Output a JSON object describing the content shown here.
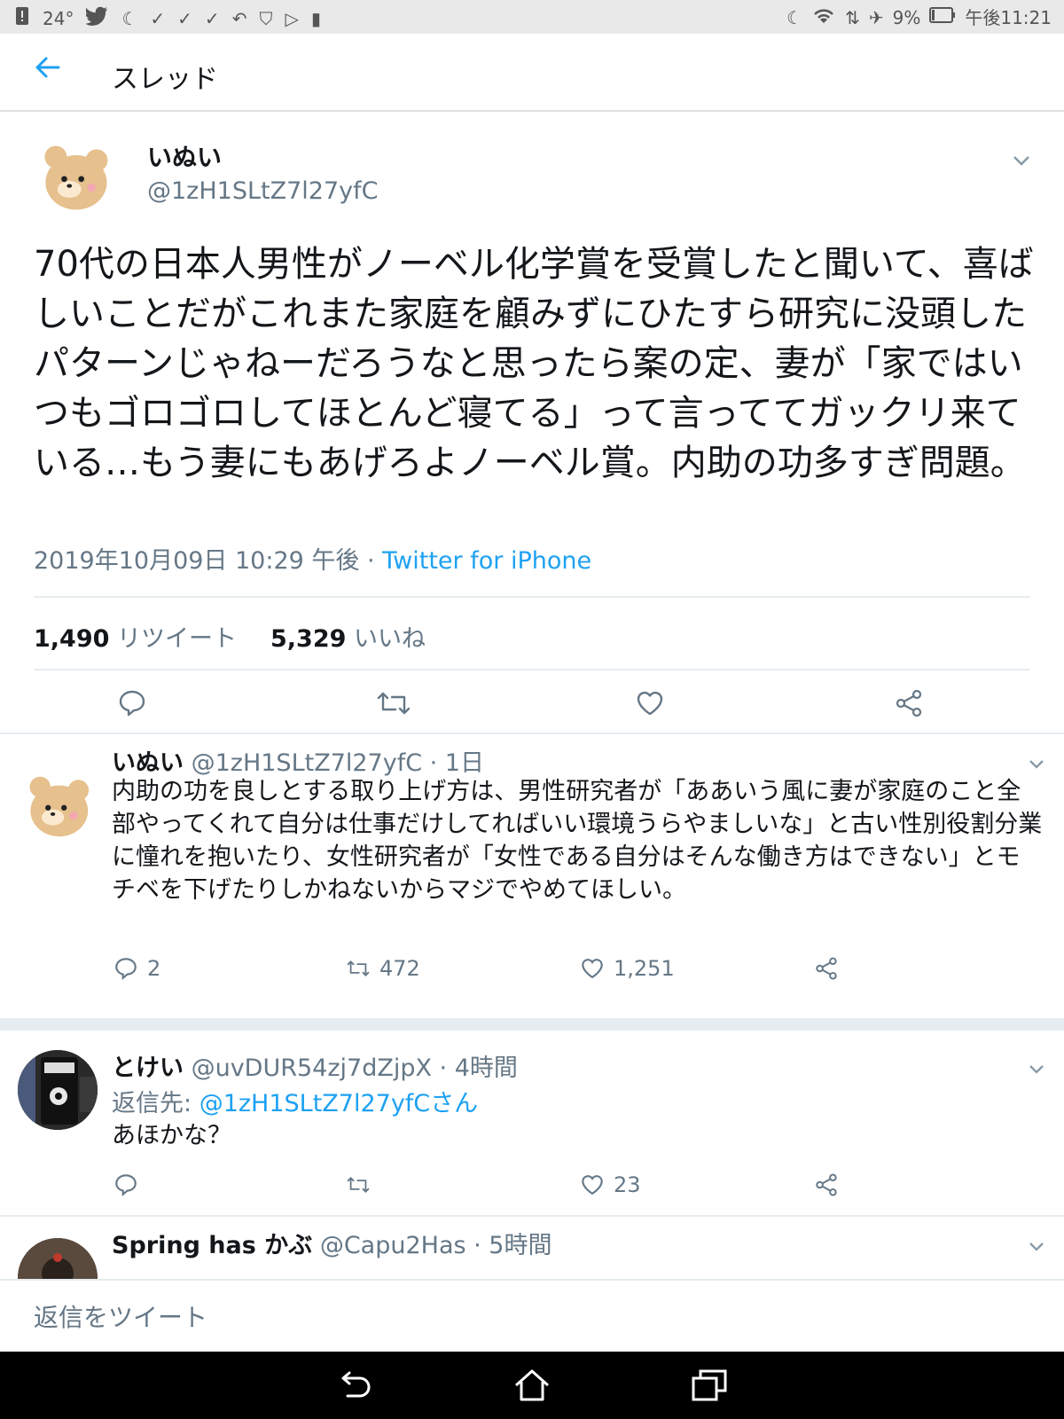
{
  "statusbar": {
    "temperature": "24°",
    "battery": "9%",
    "time": "午後11:21",
    "icons_left": [
      "alert-icon",
      "twitter-icon",
      "moon-icon",
      "check-icon",
      "check-icon",
      "check-icon",
      "reply-arrow-icon",
      "shield-icon",
      "play-store-icon",
      "sd-card-icon"
    ],
    "icons_right": [
      "moon-icon",
      "wifi-icon",
      "data-arrows-icon",
      "airplane-icon",
      "battery-icon"
    ]
  },
  "header": {
    "back_icon": "arrow-left-icon",
    "title": "スレッド"
  },
  "main_tweet": {
    "name": "いぬい",
    "handle": "@1zH1SLtZ7l27yfC",
    "text": "70代の日本人男性がノーベル化学賞を受賞したと聞いて、喜ばしいことだがこれまた家庭を顧みずにひたすら研究に没頭したパターンじゃねーだろうなと思ったら案の定、妻が「家ではいつもゴロゴロしてほとんど寝てる」って言っててガックリ来ている…もう妻にもあげろよノーベル賞。内助の功多すぎ問題。",
    "date": "2019年10月09日 10:29 午後 · ",
    "client": "Twitter for iPhone",
    "retweets_count": "1,490",
    "retweets_label": "リツイート",
    "likes_count": "5,329",
    "likes_label": "いいね"
  },
  "replies": [
    {
      "name": "いぬい",
      "handle_time": "@1zH1SLtZ7l27yfC · 1日",
      "text": "内助の功を良しとする取り上げ方は、男性研究者が「ああいう風に妻が家庭のこと全部やってくれて自分は仕事だけしてればいい環境うらやましいな」と古い性別役割分業に憧れを抱いたり、女性研究者が「女性である自分はそんな働き方はできない」とモチベを下げたりしかねないからマジでやめてほしい。",
      "reply_count": "2",
      "retweet_count": "472",
      "like_count": "1,251"
    },
    {
      "name": "とけい",
      "handle_time": "@uvDUR54zj7dZjpX · 4時間",
      "replying_to_label": "返信先: ",
      "replying_to": "@1zH1SLtZ7l27yfCさん",
      "text": "あほかな？",
      "reply_count": "",
      "retweet_count": "",
      "like_count": "23"
    },
    {
      "name": "Spring has かぶ",
      "handle_time": "@Capu2Has · 5時間"
    }
  ],
  "composer": {
    "placeholder": "返信をツイート"
  },
  "colors": {
    "accent": "#1da1f2",
    "secondary_text": "#657786",
    "border": "#e6ecf0"
  }
}
